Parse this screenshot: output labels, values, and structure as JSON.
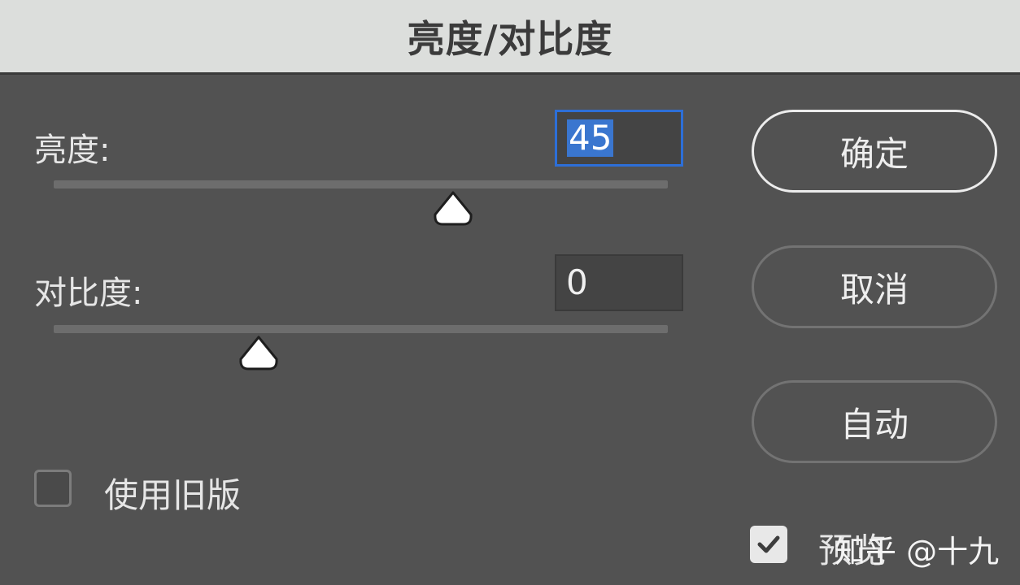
{
  "dialog": {
    "title": "亮度/对比度"
  },
  "brightness": {
    "label": "亮度:",
    "value": "45",
    "slider_value": 45,
    "slider_min": -150,
    "slider_max": 150
  },
  "contrast": {
    "label": "对比度:",
    "value": "0",
    "slider_value": 0,
    "slider_min": -50,
    "slider_max": 100
  },
  "buttons": {
    "ok": "确定",
    "cancel": "取消",
    "auto": "自动"
  },
  "legacy": {
    "label": "使用旧版",
    "checked": false
  },
  "preview": {
    "label": "预览",
    "checked": true
  },
  "watermark": "知乎 @十九",
  "colors": {
    "focus_border": "#2d6fd8",
    "selection": "#3a76cf",
    "panel": "#525252"
  },
  "icons": {
    "slider_thumb": "slider-thumb-icon",
    "checkmark": "checkmark-icon"
  }
}
